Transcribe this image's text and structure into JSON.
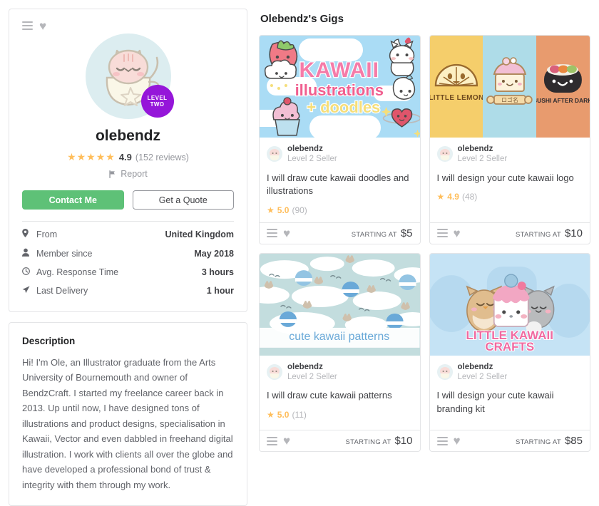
{
  "profile": {
    "username": "olebendz",
    "level_badge": {
      "line1": "LEVEL",
      "line2": "TWO"
    },
    "rating_value": "4.9",
    "rating_count": "(152 reviews)",
    "stars": "★★★★★",
    "report_label": "Report",
    "report_icon": "flag-icon",
    "menu_icon": "hamburger-icon",
    "favorite_icon": "heart-icon",
    "buttons": {
      "contact": "Contact Me",
      "quote": "Get a Quote"
    },
    "stats": [
      {
        "icon": "location-pin-icon",
        "label": "From",
        "value": "United Kingdom"
      },
      {
        "icon": "person-icon",
        "label": "Member since",
        "value": "May 2018"
      },
      {
        "icon": "clock-icon",
        "label": "Avg. Response Time",
        "value": "3 hours"
      },
      {
        "icon": "send-icon",
        "label": "Last Delivery",
        "value": "1 hour"
      }
    ]
  },
  "description": {
    "title": "Description",
    "body": "Hi! I'm Ole, an Illustrator graduate from the Arts University of Bournemouth and owner of BendzCraft. I started my freelance career back in 2013. Up until now, I have designed tons of illustrations and product designs, specialisation in Kawaii, Vector and even dabbled in freehand digital illustration. I work with clients all over the globe and have developed a professional bond of trust & integrity with them through my work."
  },
  "gigs_section": {
    "title": "Olebendz's Gigs",
    "starting_at_label": "STARTING AT",
    "gigs": [
      {
        "seller": "olebendz",
        "seller_level": "Level 2 Seller",
        "title": "I will draw cute kawaii doodles and illustrations",
        "rating": "5.0",
        "reviews": "(90)",
        "price": "$5",
        "image_alt": "kawaii-illustrations-doodles-thumbnail",
        "image_text_1": "KAWAII",
        "image_text_2": "illustrations",
        "image_text_3": "+ doodles"
      },
      {
        "seller": "olebendz",
        "seller_level": "Level 2 Seller",
        "title": "I will design your cute kawaii logo",
        "rating": "4.9",
        "reviews": "(48)",
        "price": "$10",
        "image_alt": "kawaii-logo-thumbnail",
        "panel_1_label": "LITTLE LEMON",
        "panel_3_label": "SUSHI AFTER DARK"
      },
      {
        "seller": "olebendz",
        "seller_level": "Level 2 Seller",
        "title": "I will draw cute kawaii patterns",
        "rating": "5.0",
        "reviews": "(11)",
        "price": "$10",
        "image_alt": "kawaii-patterns-thumbnail",
        "image_text_1": "cute kawaii patterns"
      },
      {
        "seller": "olebendz",
        "seller_level": "Level 2 Seller",
        "title": "I will design your cute kawaii branding kit",
        "rating": "",
        "reviews": "",
        "price": "$85",
        "image_alt": "kawaii-branding-kit-thumbnail",
        "image_text_1": "LITTLE KAWAII",
        "image_text_2": "CRAFTS"
      }
    ]
  },
  "colors": {
    "accent_green": "#5ec177",
    "level_purple": "#9516d9",
    "star_amber": "#ffbe5b",
    "border": "#e4e5e7",
    "text_muted": "#95979d",
    "sky_blue": "#aadcf5",
    "panel_yellow": "#f5ce6b",
    "panel_blue": "#aedce8",
    "panel_salmon": "#e89b6e",
    "pattern_teal": "#c3ddde",
    "branding_blue": "#c5e3f5"
  }
}
